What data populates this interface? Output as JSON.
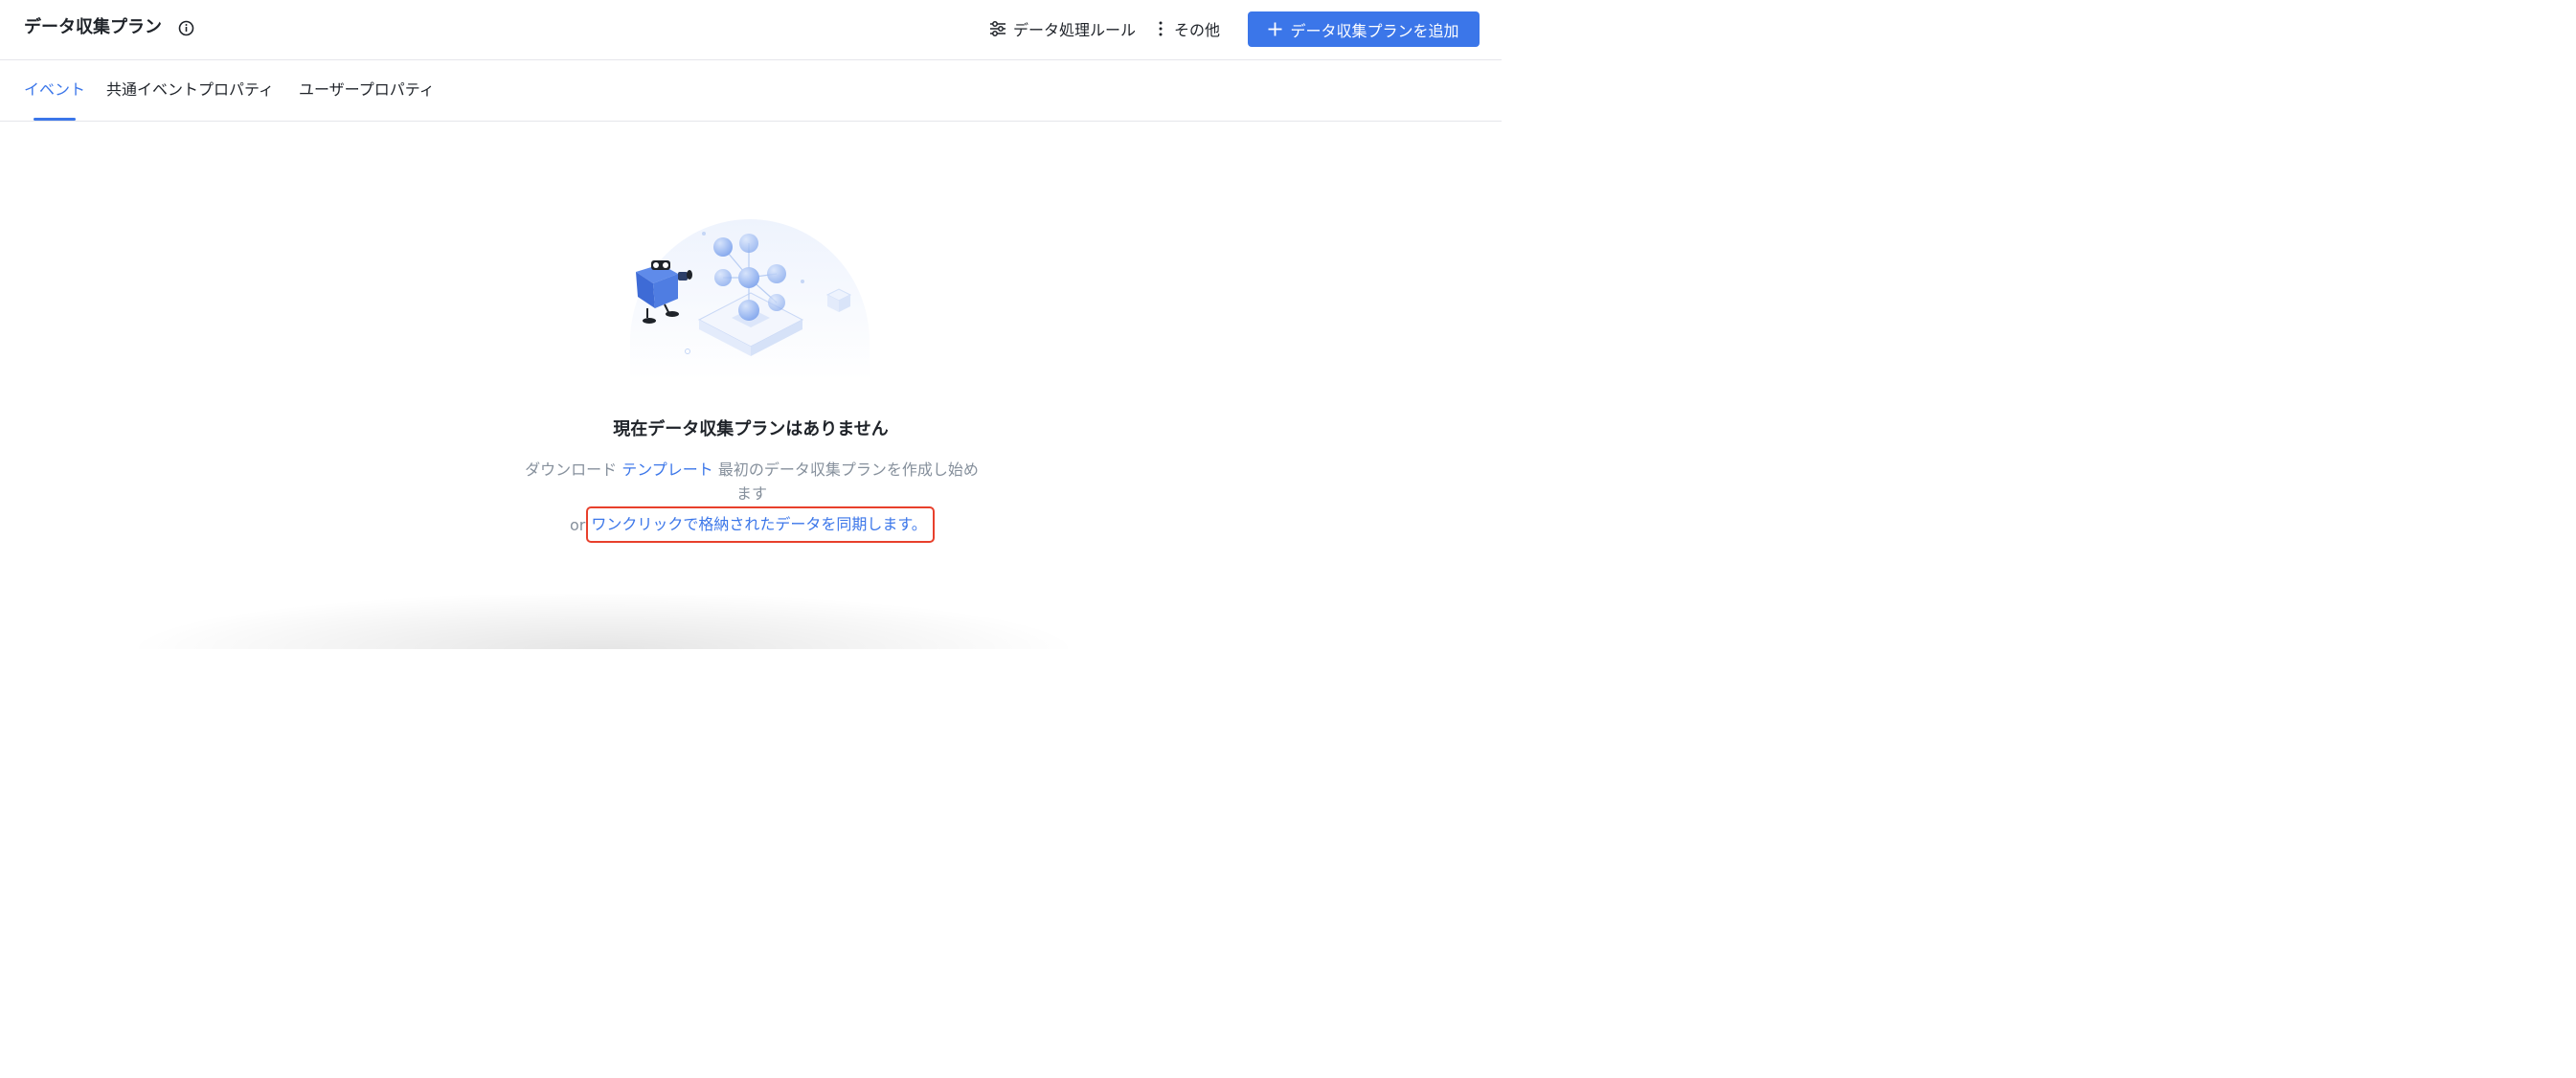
{
  "header": {
    "title": "データ収集プラン",
    "info_icon": "info-circle-icon",
    "rules_label": "データ処理ルール",
    "rules_icon": "sliders-icon",
    "more_label": "その他",
    "more_icon": "vertical-dots-icon",
    "add_label": "データ収集プランを追加",
    "add_icon": "plus-icon"
  },
  "tabs": [
    {
      "label": "イベント",
      "active": true
    },
    {
      "label": "共通イベントプロパティ",
      "active": false
    },
    {
      "label": "ユーザープロパティ",
      "active": false
    }
  ],
  "empty_state": {
    "illustration": "mascot-with-spyglass-and-node-graph",
    "title": "現在データ収集プランはありません",
    "desc_prefix": "ダウンロード",
    "desc_link": "テンプレート",
    "desc_suffix": "最初のデータ収集プランを作成し始めます",
    "or_label": "or",
    "sync_link": "ワンクリックで格納されたデータを同期します。"
  },
  "colors": {
    "accent": "#3b76e9",
    "highlight_box": "#e8402c",
    "muted_text": "#86909c"
  }
}
